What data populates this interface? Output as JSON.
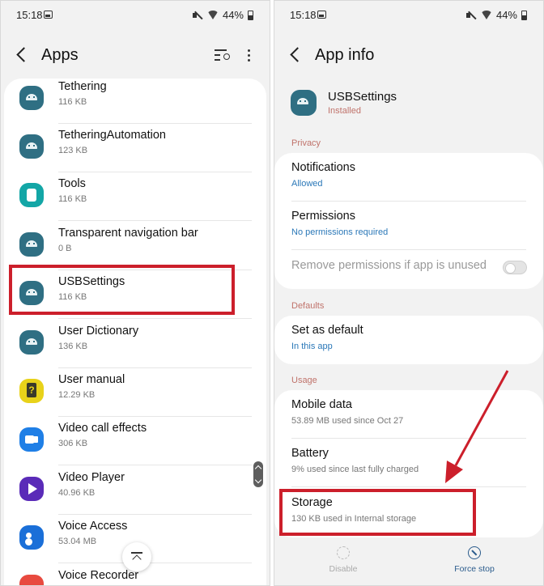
{
  "left": {
    "status": {
      "time": "15:18",
      "battery": "44%"
    },
    "header": {
      "title": "Apps"
    },
    "apps": [
      {
        "name": "Tethering",
        "size": "116 KB",
        "icon": "android-icon"
      },
      {
        "name": "TetheringAutomation",
        "size": "123 KB",
        "icon": "android-icon"
      },
      {
        "name": "Tools",
        "size": "116 KB",
        "icon": "tools-icon"
      },
      {
        "name": "Transparent navigation bar",
        "size": "0 B",
        "icon": "android-icon"
      },
      {
        "name": "USBSettings",
        "size": "116 KB",
        "icon": "android-icon"
      },
      {
        "name": "User Dictionary",
        "size": "136 KB",
        "icon": "android-icon"
      },
      {
        "name": "User manual",
        "size": "12.29 KB",
        "icon": "user-manual-icon"
      },
      {
        "name": "Video call effects",
        "size": "306 KB",
        "icon": "video-call-icon"
      },
      {
        "name": "Video Player",
        "size": "40.96 KB",
        "icon": "video-player-icon"
      },
      {
        "name": "Voice Access",
        "size": "53.04 MB",
        "icon": "voice-access-icon"
      },
      {
        "name": "Voice Recorder",
        "size": "",
        "icon": "voice-recorder-icon"
      }
    ]
  },
  "right": {
    "status": {
      "time": "15:18",
      "battery": "44%"
    },
    "header": {
      "title": "App info"
    },
    "app": {
      "name": "USBSettings",
      "status": "Installed"
    },
    "sections": {
      "privacy": "Privacy",
      "defaults": "Defaults",
      "usage": "Usage"
    },
    "privacy_items": [
      {
        "title": "Notifications",
        "sub": "Allowed"
      },
      {
        "title": "Permissions",
        "sub": "No permissions required"
      },
      {
        "title": "Remove permissions if app is unused",
        "sub": ""
      }
    ],
    "defaults_items": [
      {
        "title": "Set as default",
        "sub": "In this app"
      }
    ],
    "usage_items": [
      {
        "title": "Mobile data",
        "sub": "53.89 MB used since Oct 27"
      },
      {
        "title": "Battery",
        "sub": "9% used since last fully charged"
      },
      {
        "title": "Storage",
        "sub": "130 KB used in Internal storage"
      }
    ],
    "bottom": {
      "disable": "Disable",
      "force_stop": "Force stop"
    }
  },
  "colors": {
    "highlight": "#cc1f2b",
    "accent_blue": "#2b78b8",
    "section_label": "#c0736b"
  }
}
